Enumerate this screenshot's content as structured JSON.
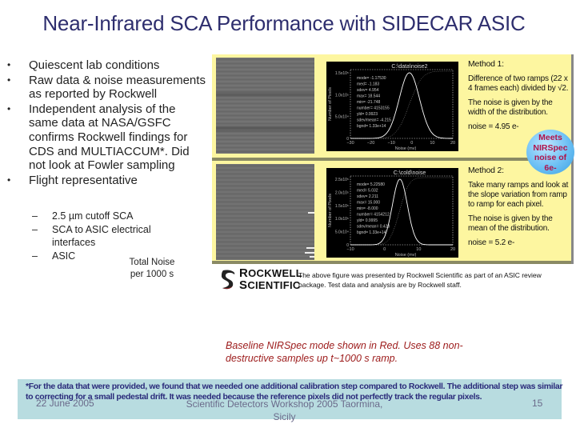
{
  "title": "Near-Infrared SCA Performance with SIDECAR ASIC",
  "bullets": [
    "Quiescent lab conditions",
    "Raw data & noise measurements as reported by Rockwell",
    "Independent analysis of the same data at NASA/GSFC confirms Rockwell findings for CDS and MULTIACCUM*. Did not look at Fowler sampling",
    "Flight representative"
  ],
  "sub_bullets": [
    "2.5 µm cutoff SCA",
    "SCA to ASIC electrical interfaces",
    "ASIC"
  ],
  "total_noise_label": [
    "Total Noise",
    "per 1000 s"
  ],
  "figure": {
    "colors": {
      "panel": "#fdf6a0",
      "badge_text": "#b0124a",
      "badge_fill": "#6cc0f4"
    },
    "method1": {
      "title": "Method 1:",
      "desc": "Difference of two ramps (22 x 4 frames each) divided by √2.",
      "note": "The noise is given by the width of the distribution.",
      "noise": "noise = 4.95 e-",
      "histogram": {
        "title": "C:\\data\\noise2",
        "xlabel": "Noise (mv)",
        "ylabel": "Number of Pixels",
        "yticks": [
          "0",
          "5.0x10⁴",
          "1.0x10⁵",
          "1.5x10⁵"
        ],
        "xticks": [
          "-30",
          "-20",
          "-10",
          "0",
          "10",
          "20"
        ],
        "xrange": [
          -30,
          20
        ],
        "stats": [
          "mode= -1.17530",
          "med= -1.183",
          "sdev= 4.954",
          "max= 18.544",
          "min= -21.748",
          "number= 4153155",
          "yld= 0.9923",
          "sdev/mean= -4.215",
          "bgnd= 1.33e+14"
        ],
        "peak": -1.2,
        "sigma": 4.95
      }
    },
    "method2": {
      "title": "Method 2:",
      "desc": "Take many ramps and look at the slope variation from ramp to ramp for each pixel.",
      "note": "The noise is given by the mean of the distribution.",
      "noise": "noise = 5.2 e-",
      "histogram": {
        "title": "C:\\cold\\noise",
        "xlabel": "Noise (mv)",
        "ylabel": "Number of Pixels",
        "yticks": [
          "0",
          "5.0x10⁴",
          "1.0x10⁵",
          "1.5x10⁵",
          "2.0x10⁵",
          "2.5x10⁵"
        ],
        "xticks": [
          "-10",
          "0",
          "10",
          "20"
        ],
        "xrange": [
          -10,
          20
        ],
        "stats": [
          "mode= 5.22580",
          "med= 5.032",
          "sdev= 2.211",
          "max= 15.000",
          "min= -8.000",
          "number= 4154212",
          "yld= 0.9995",
          "sdev/mean= 0.423",
          "bgnd= 1.33e+14"
        ],
        "peak": 4.5,
        "sigma": 2.2
      }
    },
    "badge": [
      "Meets",
      "NIRSpec",
      "noise of",
      "6e-"
    ]
  },
  "logo": {
    "line1": "Rockwell",
    "line2": "Scientific"
  },
  "caption": "The above figure was presented by Rockwell Scientific as part of an ASIC review package. Test data and analysis are by Rockwell staff.",
  "baseline_note": "Baseline NIRSpec mode shown in Red. Uses 88 non-destructive samples up t~1000 s ramp.",
  "footnote": "*For the data that were provided, we found that we needed one additional calibration step compared to Rockwell. The additional step was similar to correcting for a small pedestal drift. It was needed because the reference pixels did not perfectly track the regular pixels.",
  "footer": {
    "date": "22 June 2005",
    "conference": "Scientific Detectors Workshop 2005 Taormina, Sicily",
    "page": "15"
  }
}
